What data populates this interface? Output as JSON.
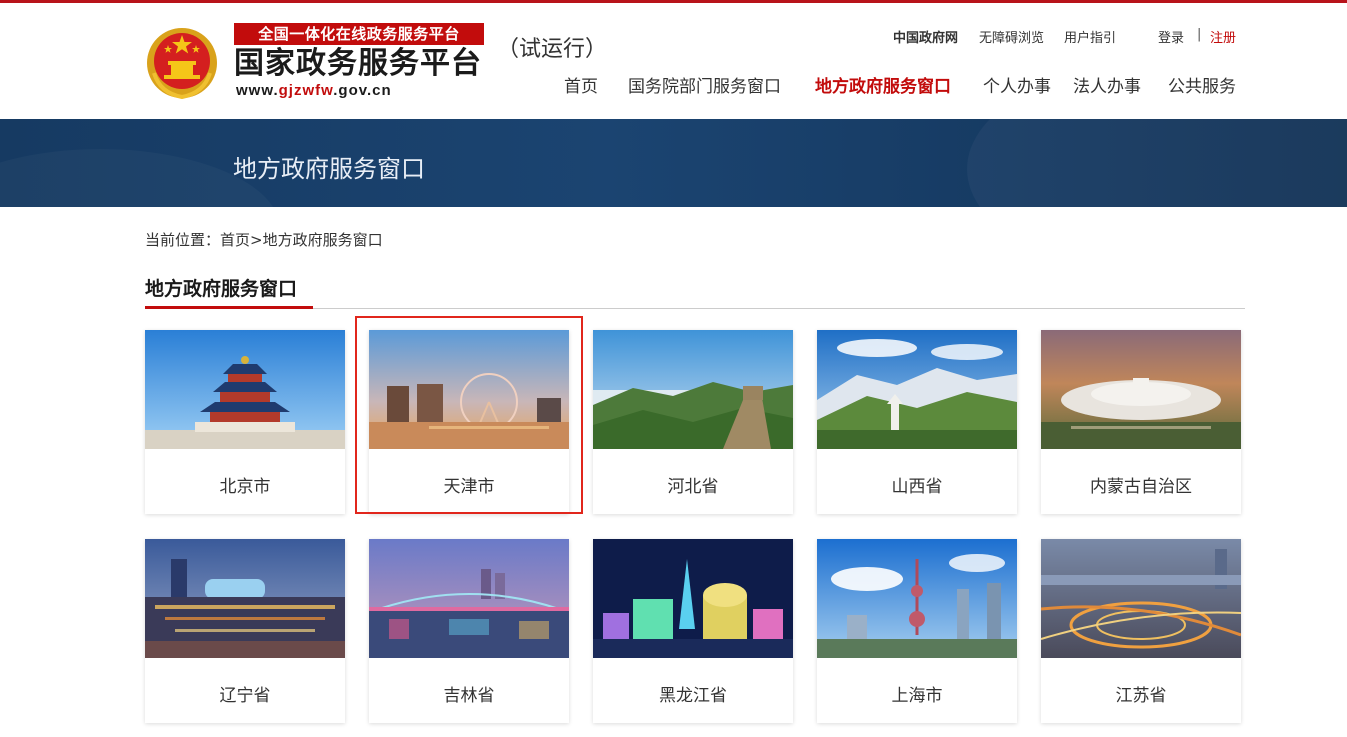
{
  "header": {
    "slogan": "全国一体化在线政务服务平台",
    "site_title": "国家政务服务平台",
    "url_prefix": "www.",
    "url_domain": "gjzwfw",
    "url_suffix": ".gov.cn",
    "trial": "（试运行）",
    "top_links": {
      "gov": "中国政府网",
      "accessible": "无障碍浏览",
      "guide": "用户指引",
      "login": "登录",
      "separator": "|",
      "register": "注册"
    },
    "nav": [
      {
        "label": "首页"
      },
      {
        "label": "国务院部门服务窗口"
      },
      {
        "label": "地方政府服务窗口",
        "active": true
      },
      {
        "label": "个人办事"
      },
      {
        "label": "法人办事"
      },
      {
        "label": "公共服务"
      }
    ]
  },
  "banner": {
    "title": "地方政府服务窗口"
  },
  "breadcrumb": {
    "prefix": "当前位置：",
    "home": "首页",
    "sep": ">",
    "current": "地方政府服务窗口"
  },
  "section": {
    "title": "地方政府服务窗口"
  },
  "regions": [
    {
      "name": "北京市"
    },
    {
      "name": "天津市",
      "highlighted": true
    },
    {
      "name": "河北省"
    },
    {
      "name": "山西省"
    },
    {
      "name": "内蒙古自治区"
    },
    {
      "name": "辽宁省"
    },
    {
      "name": "吉林省"
    },
    {
      "name": "黑龙江省"
    },
    {
      "name": "上海市"
    },
    {
      "name": "江苏省"
    }
  ],
  "colors": {
    "brand_red": "#c20c0c",
    "banner_blue": "#1b4471",
    "highlight": "#e1261c"
  }
}
